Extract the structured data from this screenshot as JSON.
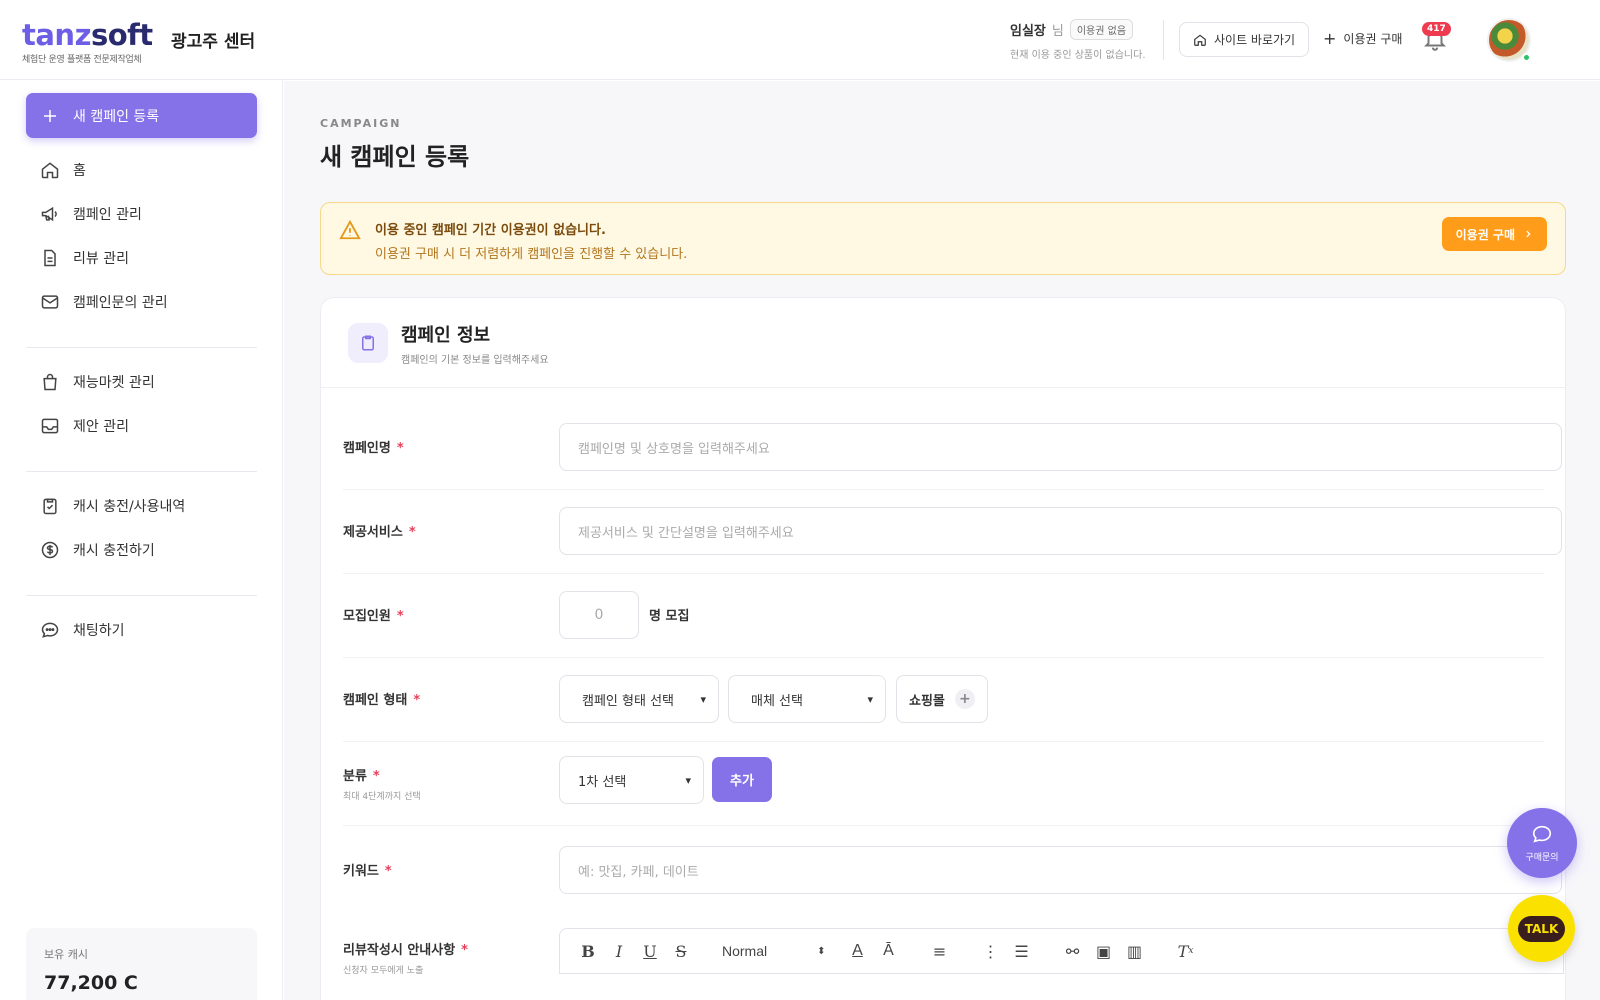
{
  "header": {
    "logo_word_a": "tanz",
    "logo_word_b": "soft",
    "logo_tagline": "체험단 운영 플랫폼 전문제작업체",
    "center_title": "광고주 센터",
    "user_name": "임실장",
    "user_suffix": "님",
    "plan_badge": "이용권 없음",
    "plan_status": "현재 이용 중인 상품이 없습니다.",
    "site_button": "사이트 바로가기",
    "buy_link": "이용권 구매",
    "notification_count": "417"
  },
  "sidebar": {
    "new_campaign": "새 캠페인 등록",
    "groups": [
      [
        {
          "label": "홈",
          "icon": "home-icon"
        },
        {
          "label": "캠페인 관리",
          "icon": "megaphone-icon"
        },
        {
          "label": "리뷰 관리",
          "icon": "document-icon"
        },
        {
          "label": "캠페인문의 관리",
          "icon": "mail-icon"
        }
      ],
      [
        {
          "label": "재능마켓 관리",
          "icon": "bag-icon"
        },
        {
          "label": "제안 관리",
          "icon": "inbox-icon"
        }
      ],
      [
        {
          "label": "캐시 충전/사용내역",
          "icon": "clipboard-check-icon"
        },
        {
          "label": "캐시 충전하기",
          "icon": "dollar-icon"
        }
      ],
      [
        {
          "label": "채팅하기",
          "icon": "chat-icon"
        }
      ]
    ],
    "cash_label": "보유 캐시",
    "cash_value": "77,200 C"
  },
  "main": {
    "eyebrow": "CAMPAIGN",
    "title": "새 캠페인 등록",
    "alert": {
      "title": "이용 중인 캠페인 기간 이용권이 없습니다.",
      "desc": "이용권 구매 시 더 저렴하게 캠페인을 진행할 수 있습니다.",
      "button": "이용권 구매"
    },
    "card": {
      "title": "캠페인 정보",
      "subtitle": "캠페인의 기본 정보를 입력해주세요",
      "fields": {
        "name_label": "캠페인명",
        "name_placeholder": "캠페인명 및 상호명을 입력해주세요",
        "service_label": "제공서비스",
        "service_placeholder": "제공서비스 및 간단설명을 입력해주세요",
        "recruit_label": "모집인원",
        "recruit_value": "0",
        "recruit_suffix": "명 모집",
        "type_label": "캠페인 형태",
        "type_select": "캠페인 형태 선택",
        "media_select": "매체 선택",
        "shopping_chip": "쇼핑몰",
        "category_label": "분류",
        "category_sub": "최대 4단계까지 선택",
        "category_select": "1차 선택",
        "category_add": "추가",
        "keyword_label": "키워드",
        "keyword_placeholder": "예: 맛집, 카페, 데이트",
        "guide_label": "리뷰작성시 안내사항",
        "guide_sub": "신청자 모두에게 노출",
        "editor_format": "Normal"
      },
      "required_mark": "*"
    }
  },
  "floating": {
    "inquiry_label": "구매문의",
    "talk_label": "TALK"
  },
  "colors": {
    "accent": "#8571e8",
    "alert_bg": "#fff9e4",
    "alert_button": "#ff9d1a",
    "badge_red": "#ef3b4f",
    "kakao_yellow": "#fae100"
  }
}
